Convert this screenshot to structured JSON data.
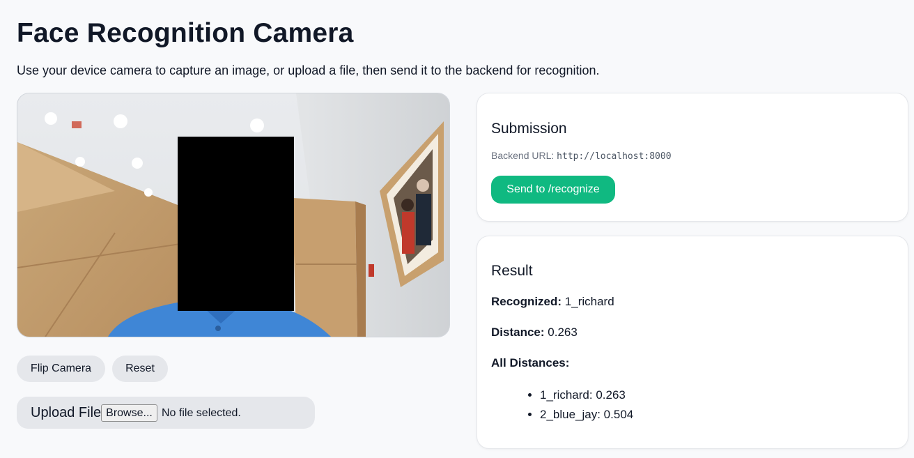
{
  "header": {
    "title": "Face Recognition Camera",
    "subtitle": "Use your device camera to capture an image, or upload a file, then send it to the backend for recognition."
  },
  "camera": {
    "flip_label": "Flip Camera",
    "reset_label": "Reset"
  },
  "upload": {
    "label": "Upload File",
    "browse_label": "Browse...",
    "status": "No file selected."
  },
  "submission": {
    "title": "Submission",
    "backend_label": "Backend URL:",
    "backend_url": "http://localhost:8000",
    "send_label": "Send to /recognize"
  },
  "result": {
    "title": "Result",
    "recognized_label": "Recognized:",
    "recognized_value": "1_richard",
    "distance_label": "Distance:",
    "distance_value": "0.263",
    "all_label": "All Distances:",
    "all_distances": [
      "1_richard: 0.263",
      "2_blue_jay: 0.504"
    ]
  },
  "colors": {
    "accent": "#10b981",
    "background": "#f8f9fb",
    "button_bg": "#e5e7eb"
  }
}
